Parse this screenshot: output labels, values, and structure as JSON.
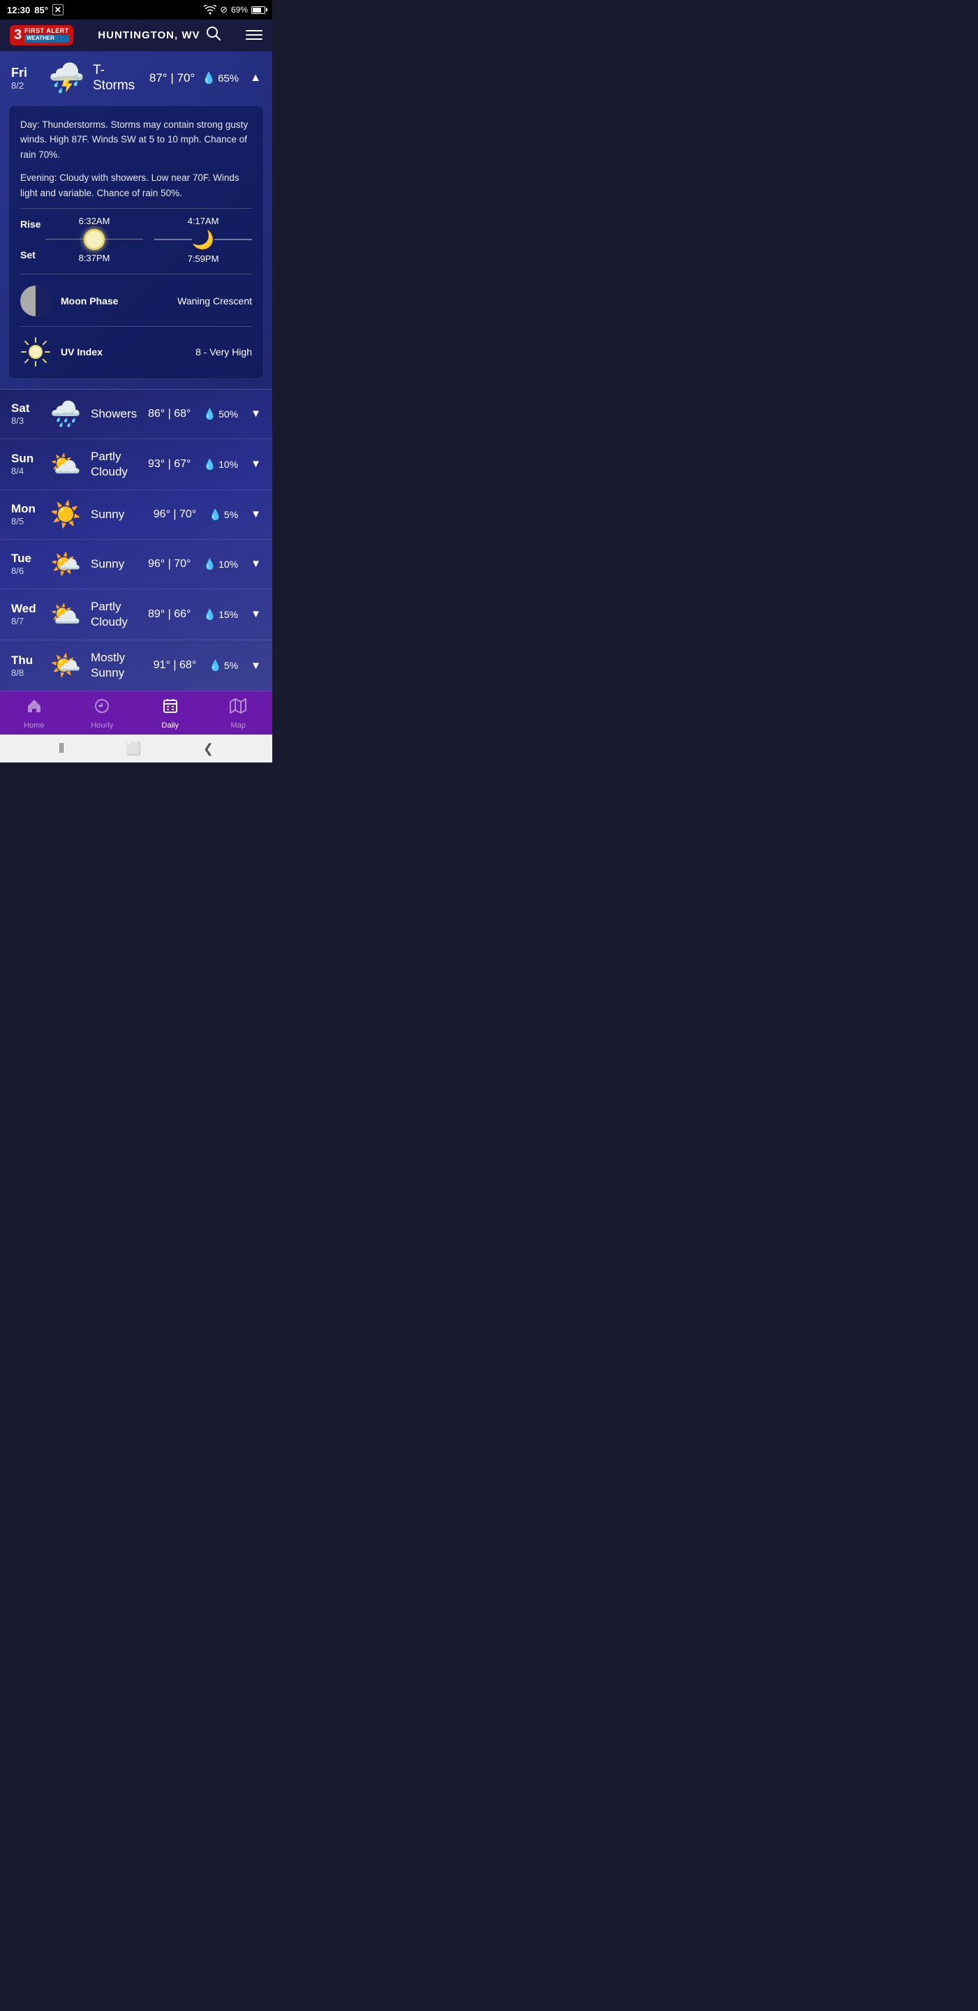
{
  "statusBar": {
    "time": "12:30",
    "temp": "85°",
    "batteryPct": "69%",
    "closeIcon": "✕",
    "wifiIcon": "wifi",
    "doNotDisturbIcon": "⊘"
  },
  "header": {
    "channelNumber": "3",
    "firstAlert": "FIRST ALERT",
    "weather": "WEATHER",
    "location": "HUNTINGTON, WV",
    "searchLabel": "search",
    "menuLabel": "menu"
  },
  "currentDay": {
    "dayName": "Fri",
    "dayDate": "8/2",
    "condition": "T-Storms",
    "highTemp": "87°",
    "lowTemp": "70°",
    "rainChance": "65%",
    "expandIcon": "▲",
    "description": {
      "day": "Day: Thunderstorms. Storms may contain strong gusty winds. High 87F. Winds SW at 5 to 10 mph. Chance of rain 70%.",
      "evening": "Evening: Cloudy with showers. Low near 70F. Winds light and variable. Chance of rain 50%."
    },
    "sunRise": "6:32AM",
    "sunSet": "8:37PM",
    "moonRise": "4:17AM",
    "moonSet": "7:59PM",
    "moonPhaseLabel": "Moon Phase",
    "moonPhaseValue": "Waning Crescent",
    "uvLabel": "UV Index",
    "uvValue": "8 - Very High",
    "riseLabel": "Rise",
    "setLabel": "Set"
  },
  "forecast": [
    {
      "dayName": "Sat",
      "dayDate": "8/3",
      "condition": "Showers",
      "highTemp": "86°",
      "lowTemp": "68°",
      "rainChance": "50%",
      "iconEmoji": "🌧️"
    },
    {
      "dayName": "Sun",
      "dayDate": "8/4",
      "condition": "Partly\nCloudy",
      "highTemp": "93°",
      "lowTemp": "67°",
      "rainChance": "10%",
      "iconEmoji": "⛅"
    },
    {
      "dayName": "Mon",
      "dayDate": "8/5",
      "condition": "Sunny",
      "highTemp": "96°",
      "lowTemp": "70°",
      "rainChance": "5%",
      "iconEmoji": "☀️"
    },
    {
      "dayName": "Tue",
      "dayDate": "8/6",
      "condition": "Sunny",
      "highTemp": "96°",
      "lowTemp": "70°",
      "rainChance": "10%",
      "iconEmoji": "🌤️"
    },
    {
      "dayName": "Wed",
      "dayDate": "8/7",
      "condition": "Partly\nCloudy",
      "highTemp": "89°",
      "lowTemp": "66°",
      "rainChance": "15%",
      "iconEmoji": "⛅"
    },
    {
      "dayName": "Thu",
      "dayDate": "8/8",
      "condition": "Mostly\nSunny",
      "highTemp": "91°",
      "lowTemp": "68°",
      "rainChance": "5%",
      "iconEmoji": "🌤️"
    }
  ],
  "bottomNav": {
    "items": [
      {
        "id": "home",
        "label": "Home",
        "icon": "🏠",
        "active": false
      },
      {
        "id": "hourly",
        "label": "Hourly",
        "icon": "◀",
        "active": false
      },
      {
        "id": "daily",
        "label": "Daily",
        "icon": "📅",
        "active": true
      },
      {
        "id": "map",
        "label": "Map",
        "icon": "🗺",
        "active": false
      }
    ]
  },
  "androidNav": {
    "backIcon": "❮",
    "homeIcon": "⬜",
    "recentIcon": "⦀"
  }
}
